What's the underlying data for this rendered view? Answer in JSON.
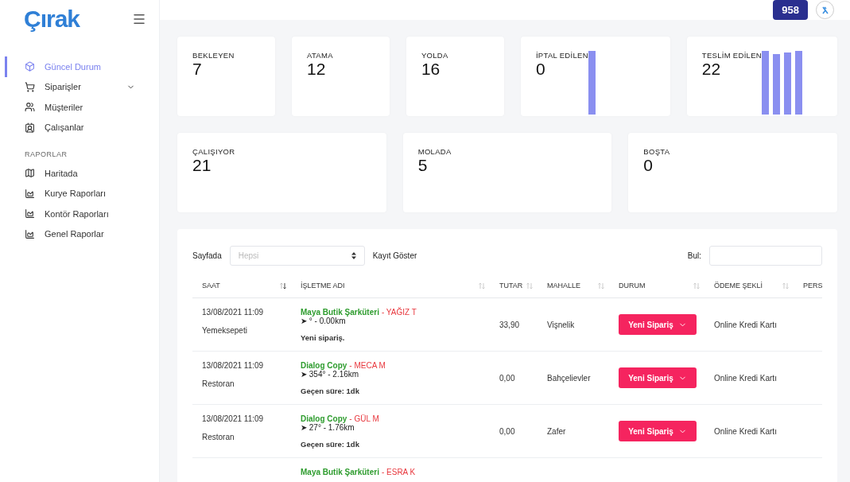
{
  "logo": "Çırak",
  "header": {
    "badge": "958"
  },
  "sidebar": {
    "items": [
      {
        "label": "Güncel Durum",
        "selected": true,
        "has_submenu": false
      },
      {
        "label": "Siparişler",
        "selected": false,
        "has_submenu": true
      },
      {
        "label": "Müşteriler",
        "selected": false,
        "has_submenu": false
      },
      {
        "label": "Çalışanlar",
        "selected": false,
        "has_submenu": false
      }
    ],
    "section": "RAPORLAR",
    "reports": [
      {
        "label": "Haritada",
        "selected": false
      },
      {
        "label": "Kurye Raporları",
        "selected": false
      },
      {
        "label": "Kontör Raporları",
        "selected": false
      },
      {
        "label": "Genel Raporlar",
        "selected": false
      }
    ]
  },
  "stats_row_1": [
    {
      "label": "BEKLEYEN",
      "value": "7"
    },
    {
      "label": "ATAMA",
      "value": "12"
    },
    {
      "label": "YOLDA",
      "value": "16"
    },
    {
      "label": "İPTAL EDİLEN",
      "value": "0",
      "kind": "bars1"
    },
    {
      "label": "TESLİM EDİLEN",
      "value": "22",
      "kind": "bars4"
    }
  ],
  "stats_row_2": [
    {
      "label": "ÇALIŞIYOR",
      "value": "21"
    },
    {
      "label": "MOLADA",
      "value": "5"
    },
    {
      "label": "BOŞTA",
      "value": "0"
    }
  ],
  "table": {
    "page_size_label": "Sayfada",
    "page_size_placeholder": "Hepsi",
    "page_size_suffix": "Kayıt Göster",
    "search_label": "Bul:",
    "columns": [
      {
        "label": "SAAT",
        "sorted": true
      },
      {
        "label": "İŞLETME ADI",
        "sorted": false
      },
      {
        "label": "TUTAR",
        "sorted": false
      },
      {
        "label": "MAHALLE",
        "sorted": false
      },
      {
        "label": "DURUM",
        "sorted": false
      },
      {
        "label": "ÖDEME ŞEKLİ",
        "sorted": false
      },
      {
        "label": "PERS"
      }
    ],
    "rows": [
      {
        "time": "13/08/2021 11:09",
        "source": "Yemeksepeti",
        "business": "Maya Butik Şarküteri",
        "courier": "- YAĞIZ T",
        "direction": "➤ ° - 0.00km",
        "note": "Yeni sipariş.",
        "amount": "33,90",
        "district": "Vişnelik",
        "status": "Yeni Sipariş",
        "payment": "Online Kredi Kartı"
      },
      {
        "time": "13/08/2021 11:09",
        "source": "Restoran",
        "business": "Dialog Copy",
        "courier": "- MECA M",
        "direction": "➤ 354° - 2.16km",
        "note": "Geçen süre: 1dk",
        "amount": "0,00",
        "district": "Bahçelievler",
        "status": "Yeni Sipariş",
        "payment": "Online Kredi Kartı"
      },
      {
        "time": "13/08/2021 11:09",
        "source": "Restoran",
        "business": "Dialog Copy",
        "courier": "- GÜL M",
        "direction": "➤ 27° - 1.76km",
        "note": "Geçen süre: 1dk",
        "amount": "0,00",
        "district": "Zafer",
        "status": "Yeni Sipariş",
        "payment": "Online Kredi Kartı"
      },
      {
        "business": "Maya Butik Şarküteri",
        "courier": "- ESRA K"
      }
    ]
  }
}
